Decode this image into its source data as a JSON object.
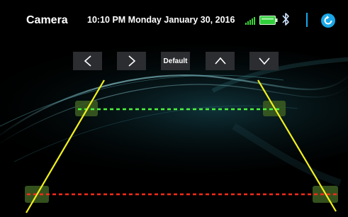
{
  "header": {
    "title": "Camera",
    "datetime": "10:10 PM Monday January 30, 2016",
    "status_icons": [
      "signal-icon",
      "battery-icon",
      "bluetooth-icon"
    ],
    "back_icon": "back-icon"
  },
  "toolbar": {
    "buttons": [
      {
        "name": "left-button",
        "icon": "chevron-left-icon"
      },
      {
        "name": "right-button",
        "icon": "chevron-right-icon"
      },
      {
        "name": "default-button",
        "label": "Default"
      },
      {
        "name": "up-button",
        "icon": "chevron-up-icon"
      },
      {
        "name": "down-button",
        "icon": "chevron-down-icon"
      }
    ]
  },
  "guidelines": {
    "near_line_color": "#ff2a1a",
    "far_line_color": "#4cf53a",
    "side_line_color": "#f2f21c",
    "handle_color": "#3a5a20"
  },
  "colors": {
    "accent": "#1aa7e8",
    "signal": "#3fd43a",
    "battery": "#2fcf3a"
  }
}
